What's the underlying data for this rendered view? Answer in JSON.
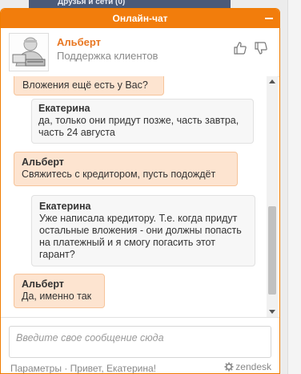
{
  "background": {
    "strip_label": "Друзья и сети (0)"
  },
  "widget": {
    "title": "Онлайн-чат",
    "agent": {
      "name": "Альберт",
      "role": "Поддержка клиентов"
    }
  },
  "messages": [
    {
      "type": "agent",
      "author": "",
      "text": "Вложения ещё есть у Вас?"
    },
    {
      "type": "visitor",
      "author": "Екатерина",
      "text": "да, только они придут позже, часть завтра, часть 24 августа"
    },
    {
      "type": "agent",
      "author": "Альберт",
      "text": "Свяжитесь с кредитором, пусть подождёт"
    },
    {
      "type": "visitor",
      "author": "Екатерина",
      "text": "Уже написала кредитору. Т.е. когда придут остальные вложения - они должны попасть на платежный и я смогу погасить этот гарант?"
    },
    {
      "type": "agent",
      "author": "Альберт",
      "text": "Да, именно так"
    }
  ],
  "input": {
    "placeholder": "Введите свое сообщение сюда"
  },
  "footer": {
    "settings_label": "Параметры",
    "separator": "·",
    "greeting": "Привет, Екатерина!",
    "brand": "zendesk"
  },
  "colors": {
    "accent": "#f27d0c",
    "agent_bubble": "#fde4d0",
    "visitor_bubble": "#f7f7f7"
  }
}
